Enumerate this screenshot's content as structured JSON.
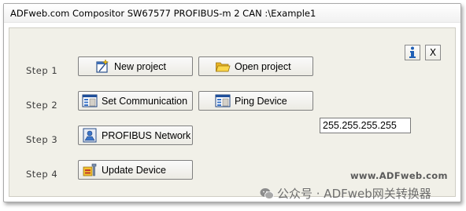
{
  "window": {
    "title": "ADFweb.com Compositor SW67577 PROFIBUS-m 2 CAN :\\Example1"
  },
  "steps": [
    {
      "label": "Step 1"
    },
    {
      "label": "Step 2"
    },
    {
      "label": "Step 3"
    },
    {
      "label": "Step 4"
    }
  ],
  "buttons": {
    "new_project": {
      "label": "New project",
      "icon": "new-project-icon"
    },
    "open_project": {
      "label": "Open project",
      "icon": "folder-icon"
    },
    "set_communication": {
      "label": "Set Communication",
      "icon": "communication-window-icon"
    },
    "ping_device": {
      "label": "Ping Device",
      "icon": "ping-window-icon"
    },
    "profibus_network": {
      "label": "PROFIBUS Network",
      "icon": "network-icon"
    },
    "update_device": {
      "label": "Update Device",
      "icon": "update-device-icon"
    }
  },
  "ip_address": {
    "value": "255.255.255.255"
  },
  "info_button": {
    "icon": "info-icon",
    "label": "i"
  },
  "close_button": {
    "icon": "close-icon",
    "label": "X"
  },
  "website": "www.ADFweb.com",
  "watermark": {
    "text": "公众号 · ADFweb网关转换器",
    "icon": "wechat-icon"
  },
  "colors": {
    "panel_background": "#f1f0e8",
    "info_icon": "#1f5fb5",
    "folder": "#f2c230"
  }
}
